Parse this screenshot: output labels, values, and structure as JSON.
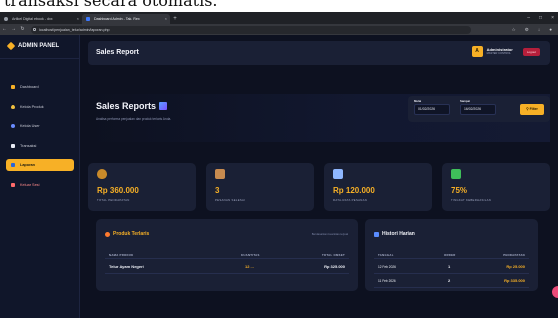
{
  "caption": "transaksi secara otomatis.",
  "browser": {
    "tabs": [
      {
        "label": "Artikel Digital ebook - dxx"
      },
      {
        "label": "Dashboard Admin - Tak. Rex"
      }
    ],
    "url": "localhost/penjualan_telur/admin/laporan.php"
  },
  "sidebar": {
    "brand": "ADMIN PANEL",
    "items": [
      {
        "label": "Dashboard"
      },
      {
        "label": "Kelola Produk"
      },
      {
        "label": "Kelola User"
      },
      {
        "label": "Transaksi"
      },
      {
        "label": "Laporan"
      },
      {
        "label": "Keluar Sesi"
      }
    ],
    "active_index": 4
  },
  "topbar": {
    "title": "Sales Report",
    "avatar_letter": "A",
    "user_name": "Administrator",
    "user_role": "MASTER CONTROL",
    "logout_label": "Logout"
  },
  "hero": {
    "title": "Sales Reports",
    "subtitle": "Analisa performa penjualan dan produk terlaris Anda.",
    "filter": {
      "start_label": "Mulai",
      "start_value": "01/02/2026",
      "end_label": "Sampai",
      "end_value": "16/02/2026",
      "button_label": "Filter"
    }
  },
  "stats": [
    {
      "value": "Rp 360.000",
      "label": "TOTAL PENDAPATAN"
    },
    {
      "value": "3",
      "label": "PESANAN SELESAI"
    },
    {
      "value": "Rp 120.000",
      "label": "RATA-RATA PESANAN"
    },
    {
      "value": "75%",
      "label": "TINGKAT KEBERHASILAN"
    }
  ],
  "top_products": {
    "title": "Produk Terlaris",
    "note": "Berdasarkan kuantitas terjual",
    "columns": [
      "NAMA PRODUK",
      "KUANTITAS",
      "TOTAL OMSET"
    ],
    "rows": [
      {
        "name": "Telur Ayam Negeri",
        "qty": "12 ...",
        "total": "Rp 325.000"
      }
    ]
  },
  "daily_history": {
    "title": "Histori Harian",
    "columns": [
      "TANGGAL",
      "ORDER",
      "PENDAPATAN"
    ],
    "rows": [
      {
        "date": "12 Feb 2026",
        "order": "1",
        "income": "Rp 25.000"
      },
      {
        "date": "11 Feb 2026",
        "order": "2",
        "income": "Rp 335.000"
      }
    ]
  },
  "colors": {
    "accent": "#f7b026",
    "background": "#0d1120",
    "panel": "#1a2035",
    "danger": "#b51f3b"
  }
}
